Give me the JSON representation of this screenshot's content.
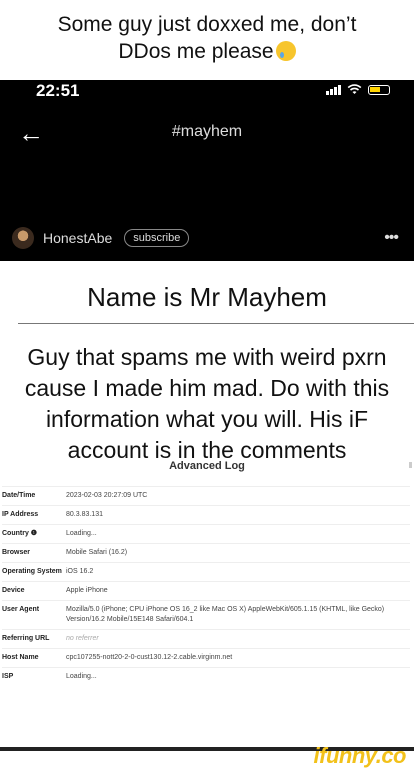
{
  "caption": {
    "line1": "Some guy just doxxed me, don’t",
    "line2": "DDos me please"
  },
  "status_bar": {
    "time": "22:51"
  },
  "header": {
    "title": "#mayhem"
  },
  "author": {
    "name": "HonestAbe",
    "subscribe_label": "subscribe",
    "more": "•••"
  },
  "post": {
    "title": "Name is Mr Mayhem",
    "body": "Guy that spams me with weird pxrn cause I made him mad. Do with this information what you will. His iF account is in the comments"
  },
  "log": {
    "title": "Advanced Log",
    "rows": [
      {
        "key": "Date/Time",
        "value": "2023-02-03 20:27:09 UTC"
      },
      {
        "key": "IP Address",
        "value": "80.3.83.131"
      },
      {
        "key": "Country ❶",
        "value": "Loading..."
      },
      {
        "key": "Browser",
        "value": "Mobile Safari (16.2)"
      },
      {
        "key": "Operating System",
        "value": "iOS 16.2"
      },
      {
        "key": "Device",
        "value": "Apple iPhone"
      },
      {
        "key": "User Agent",
        "value": "Mozilla/5.0 (iPhone; CPU iPhone OS 16_2 like Mac OS X) AppleWebKit/605.1.15 (KHTML, like Gecko) Version/16.2 Mobile/15E148 Safari/604.1"
      },
      {
        "key": "Referring URL",
        "value": "no referrer"
      },
      {
        "key": "Host Name",
        "value": "cpc107255-nott20-2-0-cust130.12-2.cable.virginm.net"
      },
      {
        "key": "ISP",
        "value": "Loading..."
      }
    ]
  },
  "watermark": {
    "text": "ifunny.co"
  }
}
